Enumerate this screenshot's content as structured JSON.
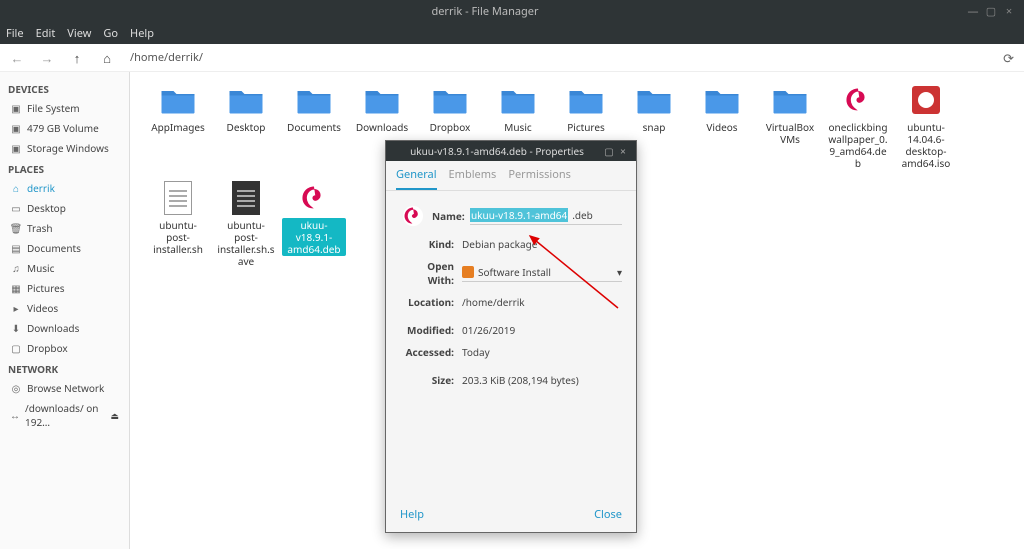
{
  "window": {
    "title": "derrik - File Manager",
    "menus": [
      "File",
      "Edit",
      "View",
      "Go",
      "Help"
    ],
    "path": "/home/derrik/"
  },
  "sidebar": {
    "sections": [
      {
        "label": "DEVICES",
        "items": [
          {
            "icon": "▣",
            "text": "File System"
          },
          {
            "icon": "▣",
            "text": "479 GB Volume"
          },
          {
            "icon": "▣",
            "text": "Storage Windows"
          }
        ]
      },
      {
        "label": "PLACES",
        "items": [
          {
            "icon": "⌂",
            "text": "derrik",
            "active": true
          },
          {
            "icon": "▭",
            "text": "Desktop"
          },
          {
            "icon": "🗑",
            "text": "Trash"
          },
          {
            "icon": "▤",
            "text": "Documents"
          },
          {
            "icon": "♫",
            "text": "Music"
          },
          {
            "icon": "▦",
            "text": "Pictures"
          },
          {
            "icon": "▸",
            "text": "Videos"
          },
          {
            "icon": "⬇",
            "text": "Downloads"
          },
          {
            "icon": "▢",
            "text": "Dropbox"
          }
        ]
      },
      {
        "label": "NETWORK",
        "items": [
          {
            "icon": "◎",
            "text": "Browse Network"
          },
          {
            "icon": "↔",
            "text": "/downloads/ on 192…",
            "eject": true
          }
        ]
      }
    ]
  },
  "files": [
    {
      "type": "folder",
      "label": "AppImages"
    },
    {
      "type": "folder",
      "label": "Desktop"
    },
    {
      "type": "folder",
      "label": "Documents"
    },
    {
      "type": "folder",
      "label": "Downloads"
    },
    {
      "type": "folder",
      "label": "Dropbox"
    },
    {
      "type": "folder",
      "label": "Music"
    },
    {
      "type": "folder",
      "label": "Pictures"
    },
    {
      "type": "folder",
      "label": "snap"
    },
    {
      "type": "folder",
      "label": "Videos"
    },
    {
      "type": "folder",
      "label": "VirtualBox VMs"
    },
    {
      "type": "deb",
      "label": "oneclickbingwallpaper_0.9_amd64.deb"
    },
    {
      "type": "iso",
      "label": "ubuntu-14.04.6-desktop-amd64.iso"
    },
    {
      "type": "doc",
      "label": "ubuntu-post-installer.sh"
    },
    {
      "type": "doc",
      "label": "ubuntu-post-installer.sh.save"
    },
    {
      "type": "deb",
      "label": "ukuu-v18.9.1-amd64.deb",
      "selected": true
    }
  ],
  "dialog": {
    "title": "ukuu-v18.9.1-amd64.deb - Properties",
    "tabs": [
      "General",
      "Emblems",
      "Permissions"
    ],
    "active_tab": 0,
    "name_highlight": "ukuu-v18.9.1-amd64",
    "name_suffix": ".deb",
    "kind": "Debian package",
    "open_with": "Software Install",
    "location": "/home/derrik",
    "modified": "01/26/2019",
    "accessed": "Today",
    "size": "203.3 KiB (208,194 bytes)",
    "labels": {
      "name": "Name:",
      "kind": "Kind:",
      "open_with": "Open With:",
      "location": "Location:",
      "modified": "Modified:",
      "accessed": "Accessed:",
      "size": "Size:"
    },
    "footer": {
      "help": "Help",
      "close": "Close"
    }
  }
}
